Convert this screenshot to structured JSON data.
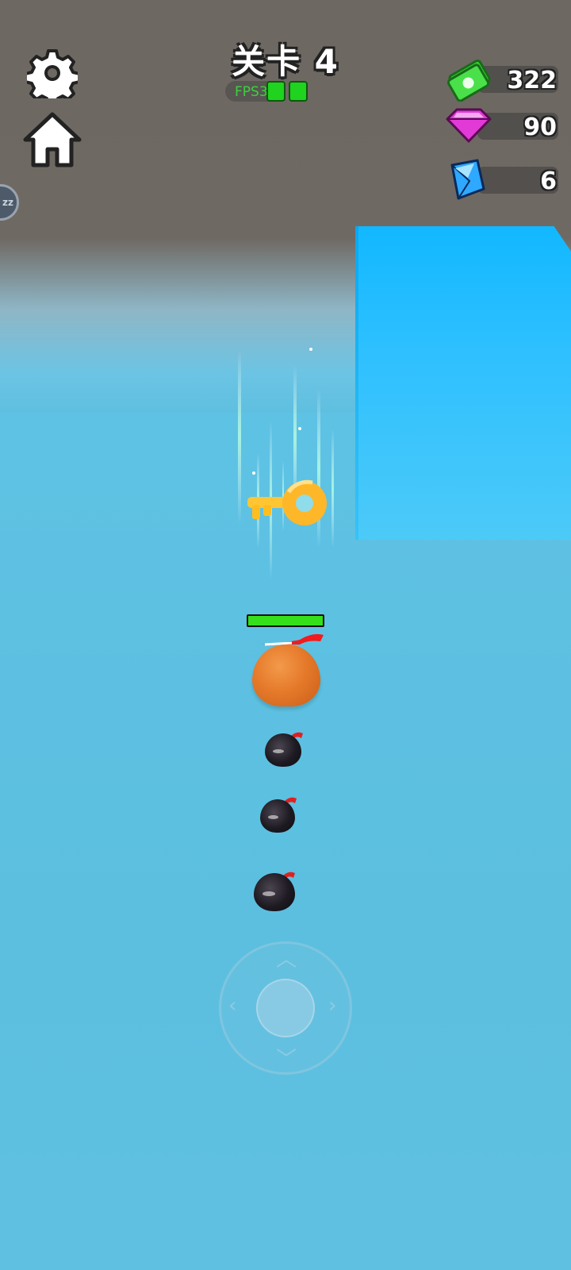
{
  "hud": {
    "level_title": "关卡 4",
    "fps_label": "FPS34",
    "settings_icon": "gear-icon",
    "home_icon": "home-icon",
    "sleep_label": "zz"
  },
  "resources": [
    {
      "name": "cash",
      "icon": "cash-icon",
      "value": "322",
      "color": "#3bd43b"
    },
    {
      "name": "gem",
      "icon": "pink-gem-icon",
      "value": "90",
      "color": "#e23ad6"
    },
    {
      "name": "crystal",
      "icon": "blue-crystal-icon",
      "value": "6",
      "color": "#2fa8ff"
    }
  ],
  "player": {
    "health_fraction": 1.0,
    "body_color": "#e67a2b"
  },
  "colors": {
    "accent_green": "#35e01a",
    "wall_blue": "#12b8ff",
    "ground": "#5fbfe0"
  }
}
